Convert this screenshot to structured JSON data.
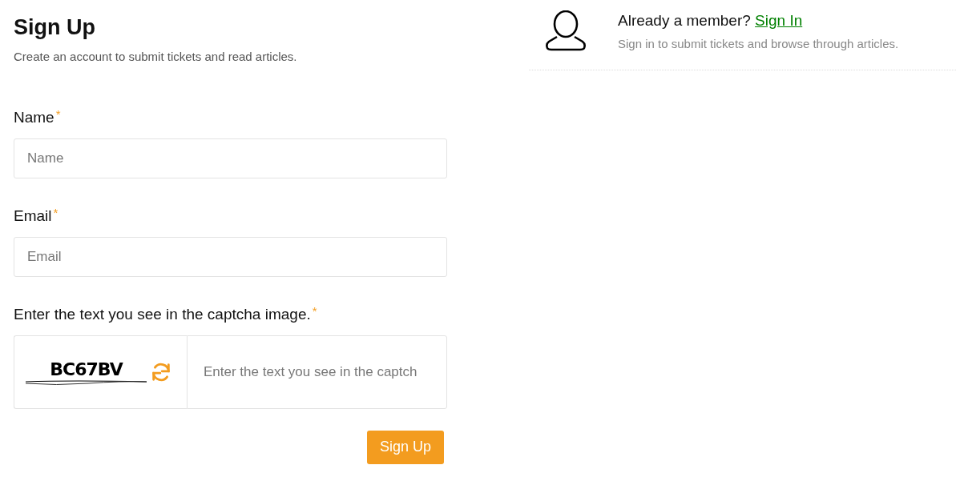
{
  "signup": {
    "title": "Sign Up",
    "subtitle": "Create an account to submit tickets and read articles.",
    "fields": [
      {
        "kind": "text",
        "label": "Name",
        "required_mark": "*",
        "placeholder": "Name"
      },
      {
        "kind": "text",
        "label": "Email",
        "required_mark": "*",
        "placeholder": "Email"
      },
      {
        "kind": "captcha",
        "label": "Enter the text you see in the captcha image.",
        "required_mark": "*",
        "captcha_text": "BC67BV",
        "placeholder": "Enter the text you see in the captch"
      }
    ],
    "submit": "Sign Up"
  },
  "signin": {
    "prompt": "Already a member?",
    "link": "Sign In",
    "hint": "Sign in to submit tickets and browse through articles."
  }
}
